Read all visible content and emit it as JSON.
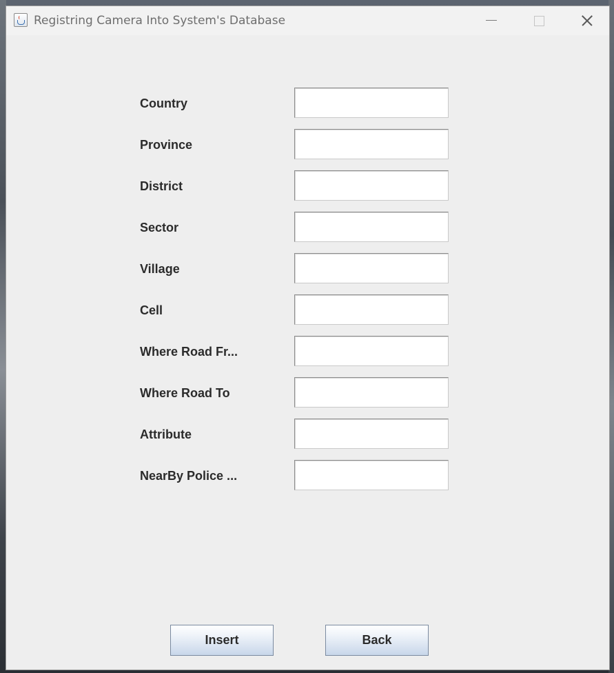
{
  "window": {
    "title": "Registring Camera Into System's Database",
    "icon": "java-cup-icon",
    "controls": {
      "minimize": "minimize-icon",
      "maximize": "maximize-icon",
      "close": "close-icon"
    }
  },
  "form": {
    "fields": [
      {
        "label": "Country",
        "value": "",
        "placeholder": ""
      },
      {
        "label": "Province",
        "value": "",
        "placeholder": ""
      },
      {
        "label": "District",
        "value": "",
        "placeholder": ""
      },
      {
        "label": "Sector",
        "value": "",
        "placeholder": ""
      },
      {
        "label": "Village",
        "value": "",
        "placeholder": ""
      },
      {
        "label": "Cell",
        "value": "",
        "placeholder": ""
      },
      {
        "label": "Where Road Fr...",
        "value": "",
        "placeholder": ""
      },
      {
        "label": "Where Road To",
        "value": "",
        "placeholder": ""
      },
      {
        "label": "Attribute",
        "value": "",
        "placeholder": ""
      },
      {
        "label": "NearBy Police ...",
        "value": "",
        "placeholder": ""
      }
    ]
  },
  "actions": {
    "insert_label": "Insert",
    "back_label": "Back"
  },
  "colors": {
    "window_bg": "#eeeeee",
    "titlebar_bg": "#f2f2f2",
    "title_text": "#6e6e6e",
    "label_text": "#2b2b2b",
    "button_gradient_bottom": "#c8d7ea"
  }
}
